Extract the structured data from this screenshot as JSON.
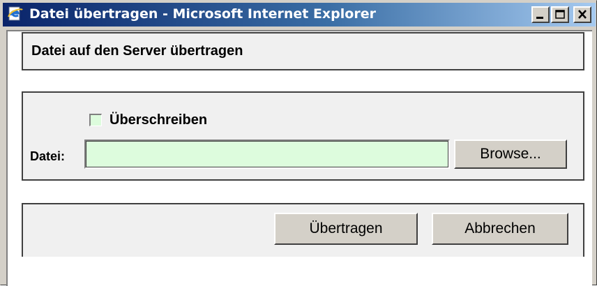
{
  "window": {
    "title": "Datei übertragen - Microsoft Internet Explorer",
    "icon": "internet-explorer-icon",
    "controls": [
      "minimize",
      "maximize",
      "close"
    ]
  },
  "dialog": {
    "heading": "Datei auf den Server übertragen",
    "overwrite": {
      "label": "Überschreiben",
      "checked": false
    },
    "file": {
      "label": "Datei:",
      "value": "",
      "browse_label": "Browse..."
    },
    "actions": {
      "submit_label": "Übertragen",
      "cancel_label": "Abbrechen"
    }
  },
  "colors": {
    "titlebar_start": "#0a246a",
    "titlebar_end": "#a6caf0",
    "field_background": "#ddfcdd",
    "panel_background": "#f0f0f0",
    "button_face": "#d4d0c8"
  }
}
